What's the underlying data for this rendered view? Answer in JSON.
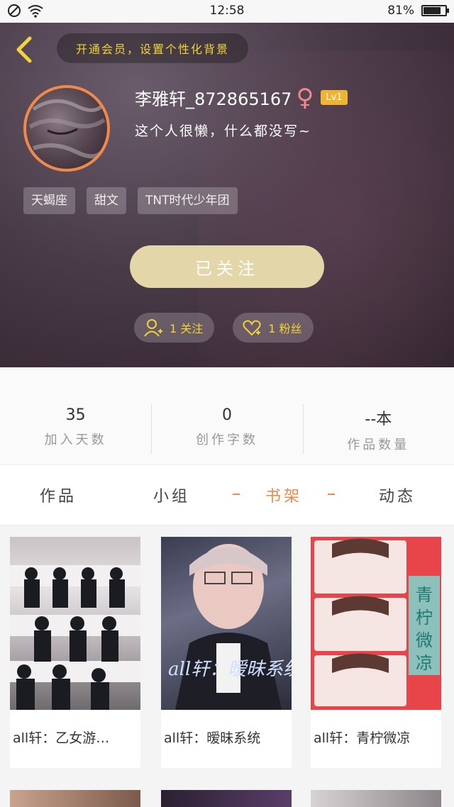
{
  "status_bar": {
    "time": "12:58",
    "battery": "81%",
    "battery_level": 0.81
  },
  "header": {
    "vip_promo": "开通会员，设置个性化背景",
    "username": "李雅轩_872865167",
    "gender_symbol": "♀",
    "level": "Lv1",
    "signature": "这个人很懒，什么都没写~",
    "tags": [
      "天蝎座",
      "甜文",
      "TNT时代少年团"
    ],
    "follow_button": "已关注",
    "following_count": "1 关注",
    "fans_count": "1 粉丝"
  },
  "stats": [
    {
      "value": "35",
      "label": "加入天数"
    },
    {
      "value": "0",
      "label": "创作字数"
    },
    {
      "value": "--本",
      "label": "作品数量"
    }
  ],
  "tabs": [
    "作品",
    "小组",
    "书架",
    "动态"
  ],
  "active_tab": "书架",
  "books": [
    {
      "title": "all轩：乙女游…",
      "cover_text": ""
    },
    {
      "title": "all轩：暧昧系统",
      "cover_text": "all轩：暧昧系统"
    },
    {
      "title": "all轩：青柠微凉",
      "cover_text": "青柠微凉"
    }
  ],
  "colors": {
    "accent": "#f0894a",
    "gold": "#f1d33a",
    "follow": "#e3d6a9"
  }
}
